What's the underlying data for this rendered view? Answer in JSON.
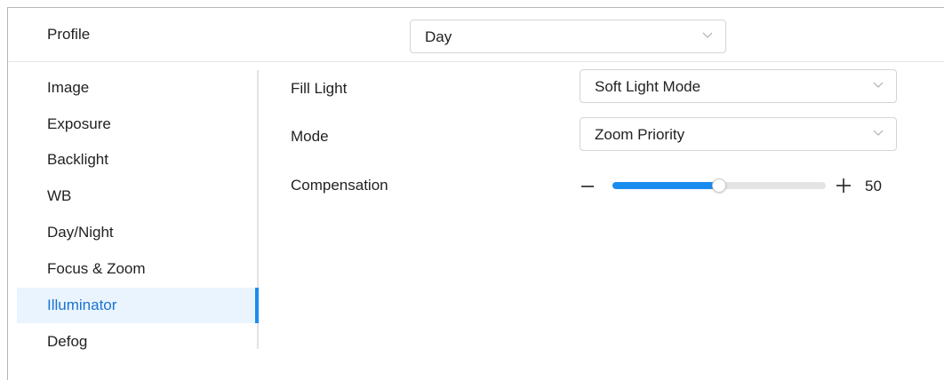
{
  "profile": {
    "label": "Profile",
    "value": "Day"
  },
  "sidebar": {
    "items": [
      {
        "label": "Image"
      },
      {
        "label": "Exposure"
      },
      {
        "label": "Backlight"
      },
      {
        "label": "WB"
      },
      {
        "label": "Day/Night"
      },
      {
        "label": "Focus & Zoom"
      },
      {
        "label": "Illuminator"
      },
      {
        "label": "Defog"
      }
    ],
    "active_index": 6
  },
  "illuminator": {
    "fill_light": {
      "label": "Fill Light",
      "value": "Soft Light Mode"
    },
    "mode": {
      "label": "Mode",
      "value": "Zoom Priority"
    },
    "compensation": {
      "label": "Compensation",
      "value": "50",
      "min": 0,
      "max": 100
    }
  },
  "colors": {
    "accent": "#1a8cf0",
    "active_bg": "#e9f4fe",
    "active_text": "#1a73d2"
  },
  "icons": {
    "dropdown": "chevron-down-icon",
    "decrease": "minus-icon",
    "increase": "plus-icon"
  }
}
